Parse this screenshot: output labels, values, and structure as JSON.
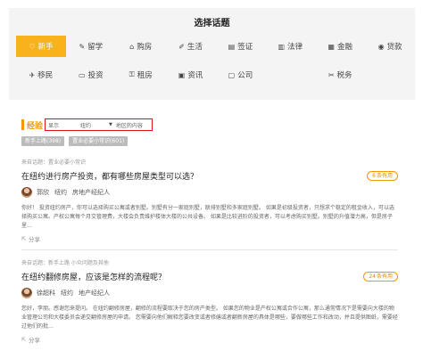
{
  "panel": {
    "title": "选择话题",
    "topics_row1": [
      {
        "label": "新手",
        "icon": "♡",
        "icon_name": "heart-icon",
        "active": true
      },
      {
        "label": "留学",
        "icon": "✎",
        "icon_name": "graduation-cap-icon",
        "active": false
      },
      {
        "label": "购房",
        "icon": "⌂",
        "icon_name": "house-icon",
        "active": false
      },
      {
        "label": "生活",
        "icon": "✐",
        "icon_name": "leaf-icon",
        "active": false
      },
      {
        "label": "签证",
        "icon": "▤",
        "icon_name": "passport-icon",
        "active": false
      },
      {
        "label": "法律",
        "icon": "▥",
        "icon_name": "law-book-icon",
        "active": false
      },
      {
        "label": "金融",
        "icon": "▦",
        "icon_name": "finance-icon",
        "active": false
      },
      {
        "label": "贷款",
        "icon": "◉",
        "icon_name": "loan-icon",
        "active": false
      }
    ],
    "topics_row2": [
      {
        "label": "移民",
        "icon": "✈",
        "icon_name": "airplane-icon",
        "active": false
      },
      {
        "label": "投资",
        "icon": "▭",
        "icon_name": "chart-icon",
        "active": false
      },
      {
        "label": "租房",
        "icon": "⚿",
        "icon_name": "key-icon",
        "active": false
      },
      {
        "label": "资讯",
        "icon": "▣",
        "icon_name": "news-icon",
        "active": false
      },
      {
        "label": "公司",
        "icon": "▢",
        "icon_name": "company-icon",
        "active": false
      },
      {
        "label": "",
        "icon": "",
        "icon_name": "",
        "active": false
      },
      {
        "label": "税务",
        "icon": "✂",
        "icon_name": "tax-icon",
        "active": false
      }
    ]
  },
  "filter": {
    "label": "经验",
    "select1": "显示",
    "select2": "纽约",
    "select3": "地区的内容"
  },
  "tags": [
    "新手上路(398)",
    "置业必要小常识(601)"
  ],
  "cards": [
    {
      "source": "来自话题：置业必要小常识",
      "question": "在纽约进行房产投资，都有哪些房屋类型可以选？",
      "answers_count": "6",
      "answers_label": "条有用",
      "author_name": "郭欣",
      "author_city": "纽约",
      "author_role": "房地产经纪人",
      "excerpt": "你好！ 投资纽约房产，你可以选择购买公寓或者别墅。别墅有分一家庭别墅，联排别墅和多家庭别墅。 如果是初级投资者，只想求个稳定的租金收入，可以选择购买公寓。产权公寓每个月交管理费，大楼会负责维护楼体大楼的公共设备。 如果是比较进阶的投资者，可以考虑购买别墅。别墅的升值潜力高，但是房子里…",
      "share": "分享"
    },
    {
      "source": "来自话题：新手上路  小众问题及其他",
      "question": "在纽约翻修房屋，应该是怎样的流程呢？",
      "answers_count": "24",
      "answers_label": "条有用",
      "author_name": "徐超科",
      "author_city": "纽约",
      "author_role": "地产经纪人",
      "excerpt": "您好，李朋。感谢您来提问。 在纽约翻修房屋，翻修的流程要取决于您的房产类型。 如果您的物业是产权公寓或合作公寓，那么通常情况下是需要向大楼的物业管理公司和大楼委员会递交翻修房屋的申请。 您需要向他们解释您要改变或者修缮或者翻新房屋的具体是哪些，要做哪些工作和改动，并且提供图纸，需要经过他们的批…",
      "share": "分享"
    }
  ]
}
